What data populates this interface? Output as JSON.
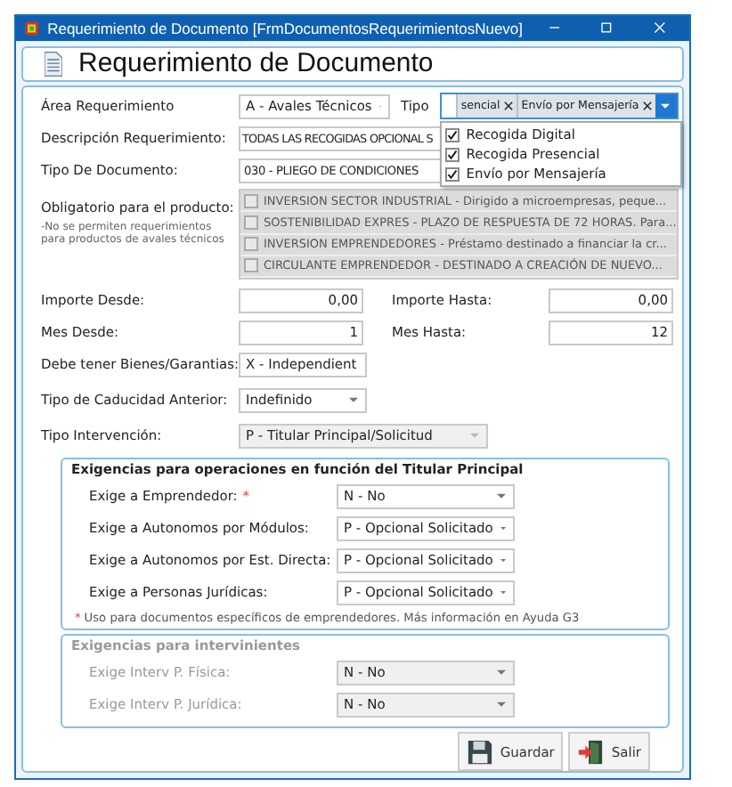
{
  "window": {
    "title": "Requerimiento de Documento [FrmDocumentosRequerimientosNuevo]"
  },
  "header": {
    "title": "Requerimiento de Documento"
  },
  "area": {
    "label": "Área Requerimiento",
    "value": "A - Avales Técnicos"
  },
  "tipo": {
    "label": "Tipo",
    "tags": [
      "sencial",
      "Envío por Mensajería"
    ],
    "options": [
      {
        "label": "Recogida Digital",
        "checked": true
      },
      {
        "label": "Recogida Presencial",
        "checked": true
      },
      {
        "label": "Envío por Mensajería",
        "checked": true
      }
    ]
  },
  "descripcion": {
    "label": "Descripción Requerimiento:",
    "value": "TODAS LAS RECOGIDAS OPCIONAL S"
  },
  "tipo_documento": {
    "label": "Tipo De Documento:",
    "value": "030 - PLIEGO DE CONDICIONES"
  },
  "obligatorio": {
    "label": "Obligatorio para el producto:",
    "note": "-No se permiten requerimientos para productos de avales técnicos",
    "disabled": true,
    "products": [
      {
        "label": "INVERSION SECTOR INDUSTRIAL - Dirigido a microempresas, peque...",
        "checked": false
      },
      {
        "label": "SOSTENIBILIDAD EXPRES - PLAZO DE RESPUESTA DE 72 HORAS. Para...",
        "checked": false
      },
      {
        "label": "INVERSION EMPRENDEDORES - Préstamo destinado a financiar la cr...",
        "checked": false
      },
      {
        "label": "CIRCULANTE EMPRENDEDOR - DESTINADO A CREACIÓN DE NUEVO...",
        "checked": false
      }
    ]
  },
  "importe_desde": {
    "label": "Importe Desde:",
    "value": "0,00"
  },
  "importe_hasta": {
    "label": "Importe Hasta:",
    "value": "0,00"
  },
  "mes_desde": {
    "label": "Mes Desde:",
    "value": "1"
  },
  "mes_hasta": {
    "label": "Mes Hasta:",
    "value": "12"
  },
  "bienes": {
    "label": "Debe tener Bienes/Garantias:",
    "value": "X - Independient",
    "disabled": false
  },
  "caducidad": {
    "label": "Tipo de Caducidad Anterior:",
    "value": "Indefinido",
    "disabled": false
  },
  "intervencion": {
    "label": "Tipo Intervención:",
    "value": "P - Titular Principal/Solicitud",
    "disabled": true
  },
  "groups": [
    {
      "title": "Exigencias para operaciones en función del Titular Principal",
      "disabled": false,
      "rows": [
        {
          "label": "Exige a Emprendedor:",
          "marker": "*",
          "value": "N - No"
        },
        {
          "label": "Exige a Autonomos por Módulos:",
          "value": "P - Opcional Solicitado"
        },
        {
          "label": "Exige a Autonomos por Est. Directa:",
          "value": "P - Opcional Solicitado"
        },
        {
          "label": "Exige a Personas Jurídicas:",
          "value": "P - Opcional Solicitado"
        }
      ],
      "footnote_marker": "*",
      "footnote": "Uso para documentos específicos de emprendedores. Más información en Ayuda G3"
    },
    {
      "title": "Exigencias para intervinientes",
      "disabled": true,
      "rows": [
        {
          "label": "Exige Interv P. Física:",
          "value": "N - No"
        },
        {
          "label": "Exige Interv P. Jurídica:",
          "value": "N - No"
        }
      ]
    }
  ],
  "buttons": [
    {
      "label": "Guardar",
      "kind": "save"
    },
    {
      "label": "Salir",
      "kind": "exit"
    }
  ]
}
